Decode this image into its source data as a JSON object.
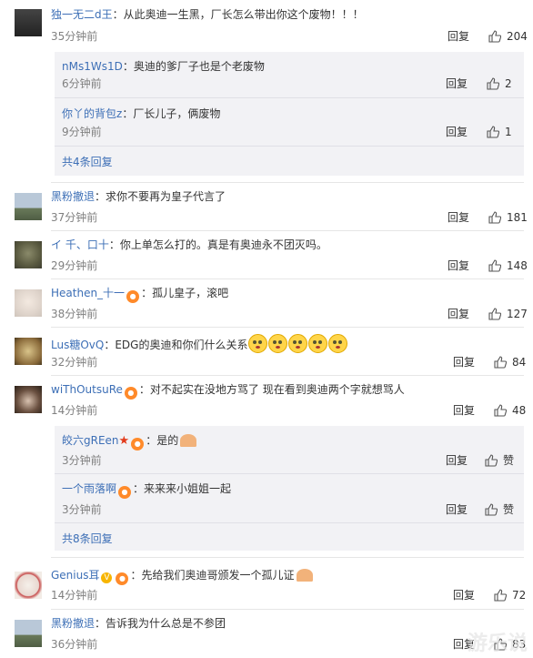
{
  "comments": [
    {
      "user": "独一无二d王",
      "sep": "：",
      "text": "从此奥迪一生黑，厂长怎么带出你这个废物！！！",
      "time": "35分钟前",
      "reply": "回复",
      "likes": "204"
    },
    {
      "user": "黑粉撤退",
      "sep": "：",
      "text": "求你不要再为皇子代言了",
      "time": "37分钟前",
      "reply": "回复",
      "likes": "181"
    },
    {
      "user": "イ 千、口十",
      "sep": "：",
      "text": "你上单怎么打的。真是有奥迪永不团灭吗。",
      "time": "29分钟前",
      "reply": "回复",
      "likes": "148"
    },
    {
      "user": "Heathen_十一",
      "sep": "：",
      "text": "孤儿皇子，滚吧",
      "time": "38分钟前",
      "reply": "回复",
      "likes": "127"
    },
    {
      "user": "Lus糖OvQ",
      "sep": "：",
      "text": "EDG的奥迪和你们什么关系",
      "time": "32分钟前",
      "reply": "回复",
      "likes": "84"
    },
    {
      "user": "wiThOutsuRe",
      "sep": "：",
      "text": "对不起实在没地方骂了 现在看到奥迪两个字就想骂人",
      "time": "14分钟前",
      "reply": "回复",
      "likes": "48"
    },
    {
      "user": "Genius耳",
      "sep": "：",
      "text": "先给我们奥迪哥颁发一个孤儿证",
      "time": "14分钟前",
      "reply": "回复",
      "likes": "72"
    },
    {
      "user": "黑粉撤退",
      "sep": "：",
      "text": "告诉我为什么总是不参团",
      "time": "36分钟前",
      "reply": "回复",
      "likes": "83"
    }
  ],
  "replies_a": [
    {
      "user": "nMs1Ws1D",
      "sep": "：",
      "text": "奥迪的爹厂子也是个老废物",
      "time": "6分钟前",
      "reply": "回复",
      "likes": "2"
    },
    {
      "user": "你丫的背包z",
      "sep": "：",
      "text": "厂长儿子，俩废物",
      "time": "9分钟前",
      "reply": "回复",
      "likes": "1"
    }
  ],
  "more_a": "共4条回复",
  "replies_b": [
    {
      "user": "皎六gREen",
      "sep": "：",
      "text": "是的",
      "time": "3分钟前",
      "reply": "回复",
      "likes": "赞"
    },
    {
      "user": "一个雨落啊",
      "sep": "：",
      "text": "来来来小姐姐一起",
      "time": "3分钟前",
      "reply": "回复",
      "likes": "赞"
    }
  ],
  "more_b": "共8条回复",
  "watermark": "游乐说"
}
